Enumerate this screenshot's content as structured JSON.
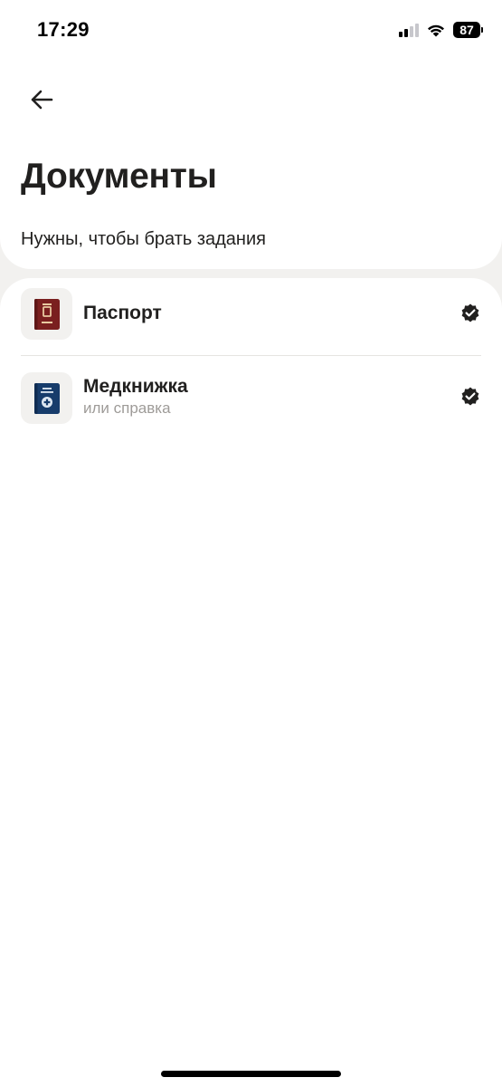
{
  "status_bar": {
    "time": "17:29",
    "battery": "87",
    "icons": [
      "cellular-signal-icon",
      "wifi-icon",
      "battery-icon"
    ]
  },
  "header": {
    "back_icon": "arrow-left-icon",
    "title": "Документы",
    "subtitle": "Нужны, чтобы брать задания"
  },
  "documents": [
    {
      "title": "Паспорт",
      "subtitle": "",
      "icon": "passport-icon",
      "icon_color": "#7a1f1f",
      "status_icon": "verified-check-icon"
    },
    {
      "title": "Медкнижка",
      "subtitle": "или справка",
      "icon": "medical-book-icon",
      "icon_color": "#173c6b",
      "status_icon": "verified-check-icon"
    }
  ],
  "colors": {
    "background": "#f2f1ef",
    "card": "#ffffff",
    "text_primary": "#21201f",
    "text_secondary": "#9e9b98"
  }
}
